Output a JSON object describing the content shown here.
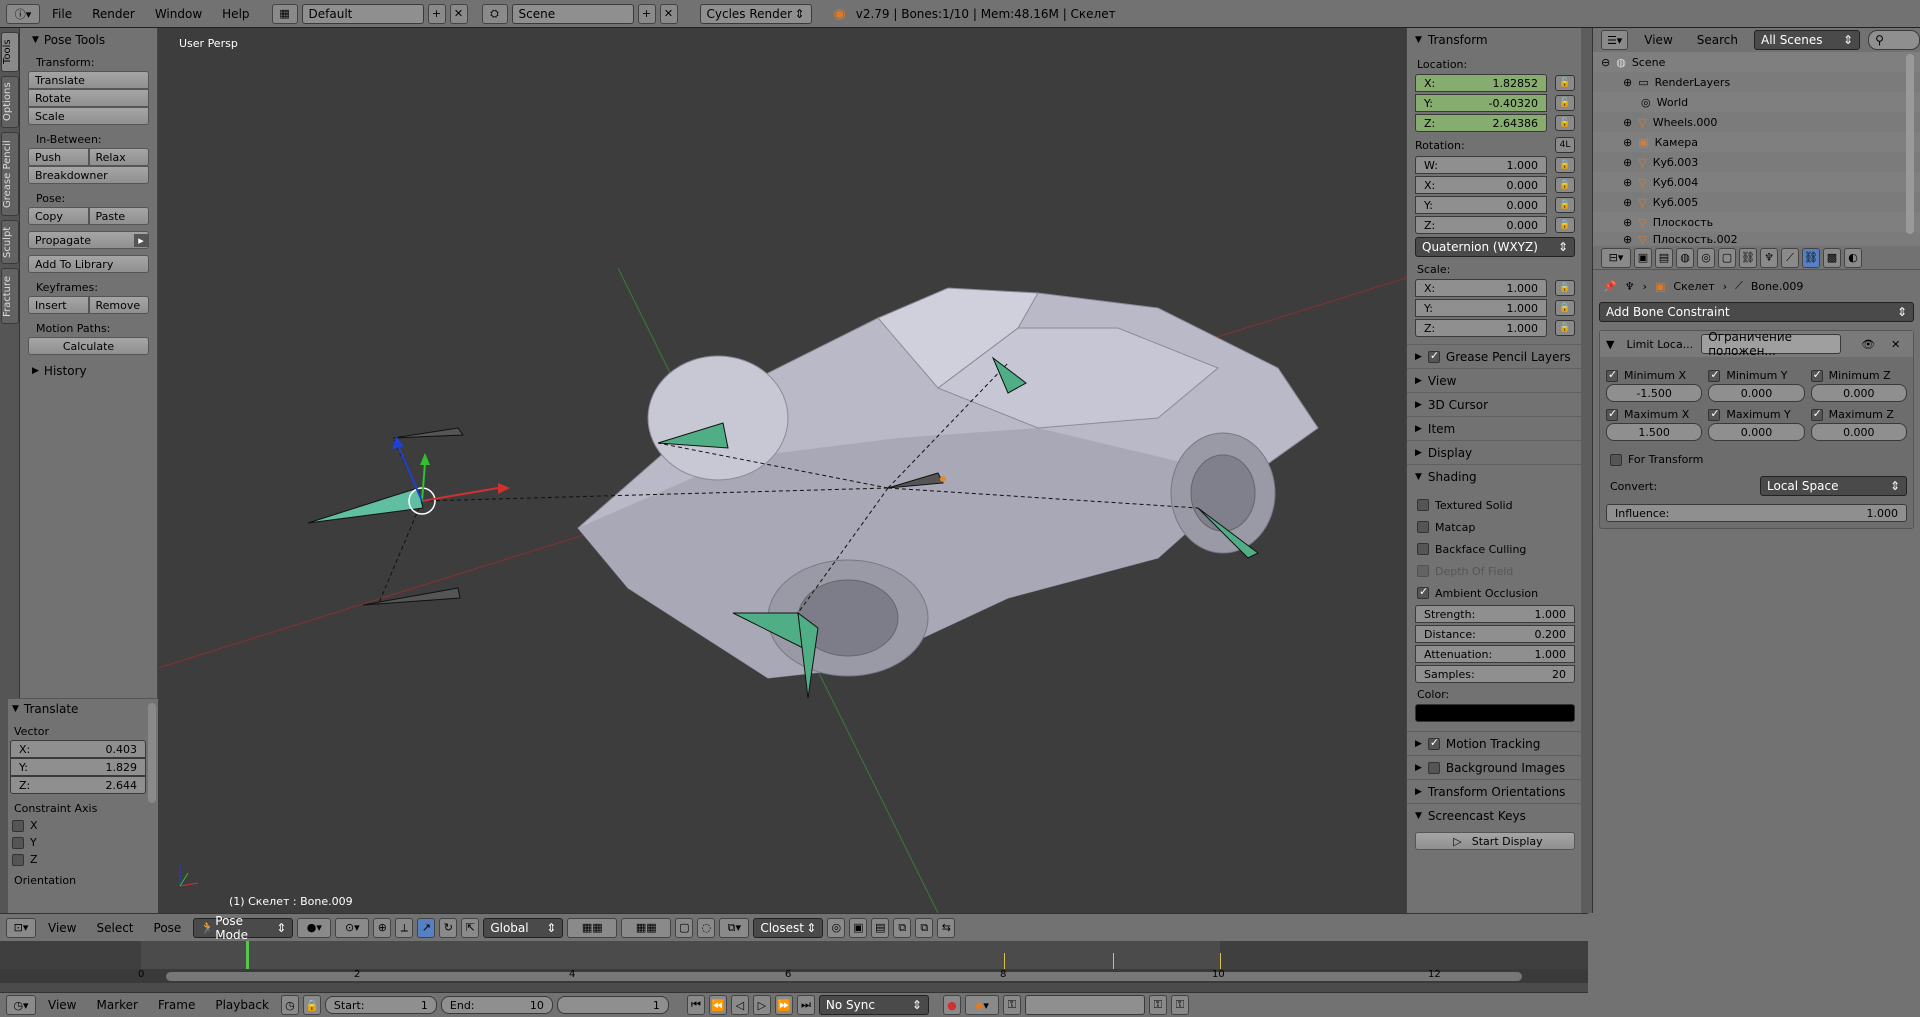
{
  "topbar": {
    "menus": [
      "File",
      "Render",
      "Window",
      "Help"
    ],
    "layout": "Default",
    "scene": "Scene",
    "engine": "Cycles Render",
    "status": "v2.79 | Bones:1/10 | Mem:48.16M | Скелет"
  },
  "vtabs": [
    "Tools",
    "Options",
    "Grease Pencil",
    "Sculpt",
    "Fracture"
  ],
  "shelf": {
    "title": "Pose Tools",
    "transform_label": "Transform:",
    "translate": "Translate",
    "rotate": "Rotate",
    "scale": "Scale",
    "inbetween_label": "In-Between:",
    "push": "Push",
    "relax": "Relax",
    "breakdowner": "Breakdowner",
    "pose_label": "Pose:",
    "copy": "Copy",
    "paste": "Paste",
    "propagate": "Propagate",
    "add_library": "Add To Library",
    "keyframes_label": "Keyframes:",
    "insert": "Insert",
    "remove": "Remove",
    "motion_label": "Motion Paths:",
    "calculate": "Calculate",
    "history": "History"
  },
  "redo": {
    "title": "Translate",
    "vector": "Vector",
    "x": "0.403",
    "y": "1.829",
    "z": "2.644",
    "constraint": "Constraint Axis",
    "axes": [
      "X",
      "Y",
      "Z"
    ],
    "orientation": "Orientation"
  },
  "viewport": {
    "view_label": "User Persp",
    "object_label": "(1) Скелет : Bone.009"
  },
  "npanel": {
    "transform": "Transform",
    "location": "Location:",
    "loc_x": "1.82852",
    "loc_y": "-0.40320",
    "loc_z": "2.64386",
    "rotation": "Rotation:",
    "rot_mode_badge": "4L",
    "rot_w": "1.000",
    "rot_x": "0.000",
    "rot_y": "0.000",
    "rot_z": "0.000",
    "rot_mode": "Quaternion (WXYZ)",
    "scale": "Scale:",
    "sc_x": "1.000",
    "sc_y": "1.000",
    "sc_z": "1.000",
    "sections1": [
      "Grease Pencil Layers",
      "View",
      "3D Cursor",
      "Item",
      "Display"
    ],
    "shading": "Shading",
    "textured": "Textured Solid",
    "matcap": "Matcap",
    "backface": "Backface Culling",
    "dof": "Depth Of Field",
    "ao": "Ambient Occlusion",
    "strength_l": "Strength:",
    "strength": "1.000",
    "distance_l": "Distance:",
    "distance": "0.200",
    "atten_l": "Attenuation:",
    "atten": "1.000",
    "samples_l": "Samples:",
    "samples": "20",
    "color": "Color:",
    "motion": "Motion Tracking",
    "bgimg": "Background Images",
    "orient": "Transform Orientations",
    "screencast": "Screencast Keys",
    "start_display": "Start Display"
  },
  "outliner": {
    "view": "View",
    "search": "Search",
    "scenes": "All Scenes",
    "items": [
      "Scene",
      "RenderLayers",
      "World",
      "Wheels.000",
      "Камера",
      "Куб.003",
      "Куб.004",
      "Куб.005",
      "Плоскость",
      "Плоскость.002"
    ]
  },
  "props": {
    "crumb_obj": "Скелет",
    "crumb_bone": "Bone.009",
    "add_constraint": "Add Bone Constraint",
    "con_name": "Limit Loca...",
    "con_label": "Ограничение положен...",
    "min_x": "Minimum X",
    "min_y": "Minimum Y",
    "min_z": "Minimum Z",
    "min_x_v": "-1.500",
    "min_y_v": "0.000",
    "min_z_v": "0.000",
    "max_x": "Maximum X",
    "max_y": "Maximum Y",
    "max_z": "Maximum Z",
    "max_x_v": "1.500",
    "max_y_v": "0.000",
    "max_z_v": "0.000",
    "for_transform": "For Transform",
    "convert": "Convert:",
    "space": "Local Space",
    "influence": "Influence:",
    "influence_v": "1.000"
  },
  "vphdr": {
    "view": "View",
    "select": "Select",
    "pose": "Pose",
    "mode": "Pose Mode",
    "orient": "Global",
    "snap": "Closest"
  },
  "timeline": {
    "ticks": [
      "0",
      "2",
      "4",
      "6",
      "8",
      "10",
      "12"
    ]
  },
  "tlhdr": {
    "view": "View",
    "marker": "Marker",
    "frame": "Frame",
    "playback": "Playback",
    "start_l": "Start:",
    "start": "1",
    "end_l": "End:",
    "end": "10",
    "current": "1",
    "sync": "No Sync"
  }
}
